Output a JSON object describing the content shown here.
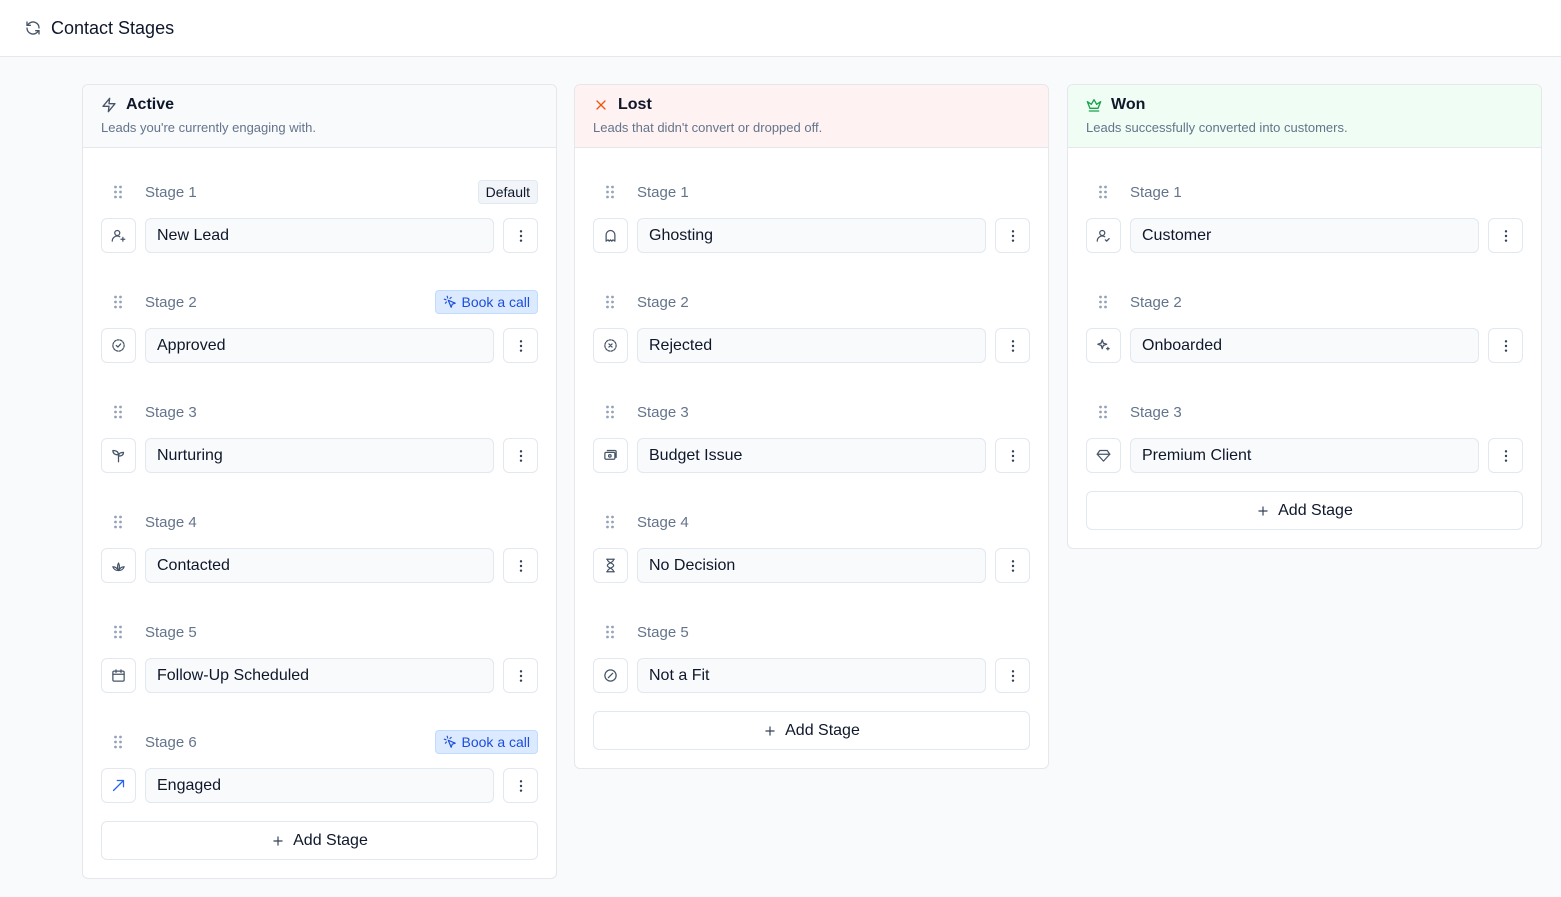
{
  "page": {
    "title": "Contact Stages",
    "icon": "refresh-icon"
  },
  "columns": [
    {
      "key": "active",
      "title": "Active",
      "description": "Leads you're currently engaging with.",
      "icon": "zap-icon",
      "header_bg": "#f8fafc",
      "accent": "#475569",
      "add_label": "Add Stage",
      "stages": [
        {
          "label": "Stage 1",
          "name": "New Lead",
          "icon": "user-plus-icon",
          "badge": "Default",
          "badge_type": "default"
        },
        {
          "label": "Stage 2",
          "name": "Approved",
          "icon": "badge-check-icon",
          "badge": "Book a call",
          "badge_type": "call"
        },
        {
          "label": "Stage 3",
          "name": "Nurturing",
          "icon": "sprout-icon",
          "badge": "",
          "badge_type": ""
        },
        {
          "label": "Stage 4",
          "name": "Contacted",
          "icon": "lotus-icon",
          "badge": "",
          "badge_type": ""
        },
        {
          "label": "Stage 5",
          "name": "Follow-Up Scheduled",
          "icon": "calendar-icon",
          "badge": "",
          "badge_type": ""
        },
        {
          "label": "Stage 6",
          "name": "Engaged",
          "icon": "trending-up-icon",
          "badge": "Book a call",
          "badge_type": "call"
        }
      ]
    },
    {
      "key": "lost",
      "title": "Lost",
      "description": "Leads that didn't convert or dropped off.",
      "icon": "x-icon",
      "header_bg": "#fef2f2",
      "accent": "#ea580c",
      "add_label": "Add Stage",
      "stages": [
        {
          "label": "Stage 1",
          "name": "Ghosting",
          "icon": "ghost-icon",
          "badge": "",
          "badge_type": ""
        },
        {
          "label": "Stage 2",
          "name": "Rejected",
          "icon": "badge-x-icon",
          "badge": "",
          "badge_type": ""
        },
        {
          "label": "Stage 3",
          "name": "Budget Issue",
          "icon": "banknote-icon",
          "badge": "",
          "badge_type": ""
        },
        {
          "label": "Stage 4",
          "name": "No Decision",
          "icon": "hourglass-icon",
          "badge": "",
          "badge_type": ""
        },
        {
          "label": "Stage 5",
          "name": "Not a Fit",
          "icon": "ban-icon",
          "badge": "",
          "badge_type": ""
        }
      ]
    },
    {
      "key": "won",
      "title": "Won",
      "description": "Leads successfully converted into customers.",
      "icon": "crown-icon",
      "header_bg": "#f0fdf4",
      "accent": "#16a34a",
      "add_label": "Add Stage",
      "stages": [
        {
          "label": "Stage 1",
          "name": "Customer",
          "icon": "user-check-icon",
          "badge": "",
          "badge_type": ""
        },
        {
          "label": "Stage 2",
          "name": "Onboarded",
          "icon": "sparkles-icon",
          "badge": "",
          "badge_type": ""
        },
        {
          "label": "Stage 3",
          "name": "Premium Client",
          "icon": "gem-icon",
          "badge": "",
          "badge_type": ""
        }
      ]
    }
  ]
}
